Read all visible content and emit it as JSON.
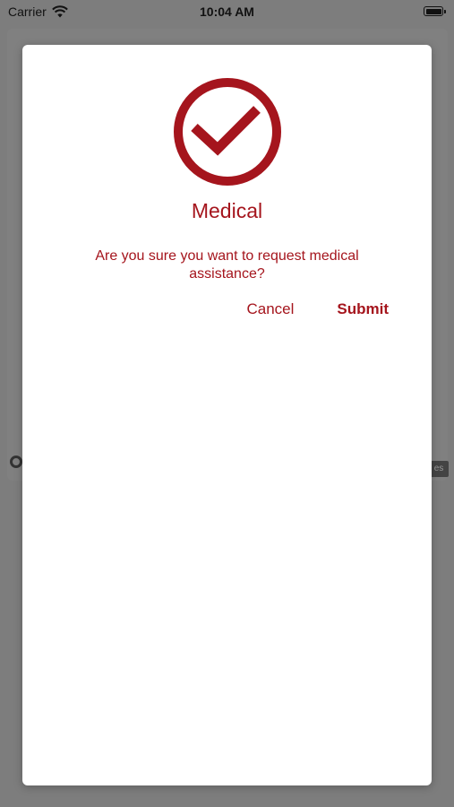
{
  "status_bar": {
    "carrier": "Carrier",
    "time": "10:04 AM"
  },
  "background": {
    "map_tag": "es"
  },
  "dialog": {
    "icon": "check-circle-icon",
    "accent_color": "#a5151d",
    "title": "Medical",
    "message": "Are you sure you want to request medical assistance?",
    "cancel_label": "Cancel",
    "submit_label": "Submit"
  }
}
